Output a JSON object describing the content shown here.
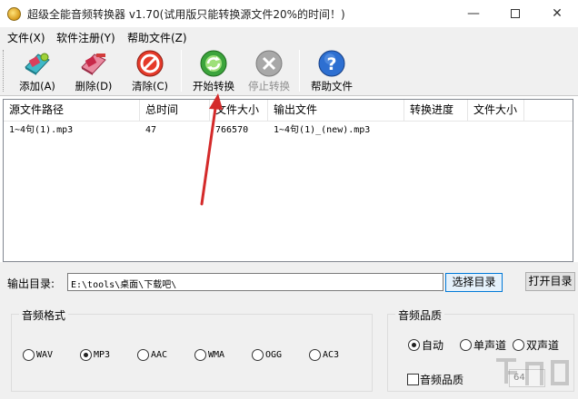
{
  "window": {
    "title": "超级全能音频转换器 v1.70(试用版只能转换源文件20%的时间！)",
    "controls": {
      "minimize": "—",
      "close": "✕"
    }
  },
  "menu": [
    {
      "label": "文件(X)"
    },
    {
      "label": "软件注册(Y)"
    },
    {
      "label": "帮助文件(Z)"
    }
  ],
  "toolbar": {
    "add": "添加(A)",
    "delete": "删除(D)",
    "clear": "清除(C)",
    "start": "开始转换",
    "stop": "停止转换",
    "help": "帮助文件",
    "icons": [
      "add-file-icon",
      "delete-file-icon",
      "clear-icon",
      "start-convert-icon",
      "stop-convert-icon",
      "help-icon"
    ]
  },
  "file_list": {
    "columns": [
      "源文件路径",
      "总时间",
      "文件大小",
      "输出文件",
      "转换进度",
      "文件大小"
    ],
    "rows": [
      {
        "source": "1~4句(1).mp3",
        "duration": "47",
        "size": "766570",
        "output": "1~4句(1)_(new).mp3",
        "progress": "",
        "out_size": ""
      }
    ]
  },
  "output": {
    "label": "输出目录:",
    "path": "E:\\tools\\桌面\\下载吧\\",
    "select_button": "选择目录",
    "open_button": "打开目录"
  },
  "audio_format": {
    "title": "音频格式",
    "options": [
      "WAV",
      "MP3",
      "AAC",
      "WMA",
      "OGG",
      "AC3"
    ],
    "selected": "MP3"
  },
  "audio_quality": {
    "title": "音频品质",
    "channel_options": [
      "自动",
      "单声道",
      "双声道"
    ],
    "selected_channel": "自动",
    "quality_checkbox": "音频品质",
    "quality_checked": false,
    "bitrate": "64"
  },
  "colors": {
    "arrow": "#d42a2a",
    "accent_border": "#0078d7",
    "panel_bg": "#f0f0f0"
  }
}
